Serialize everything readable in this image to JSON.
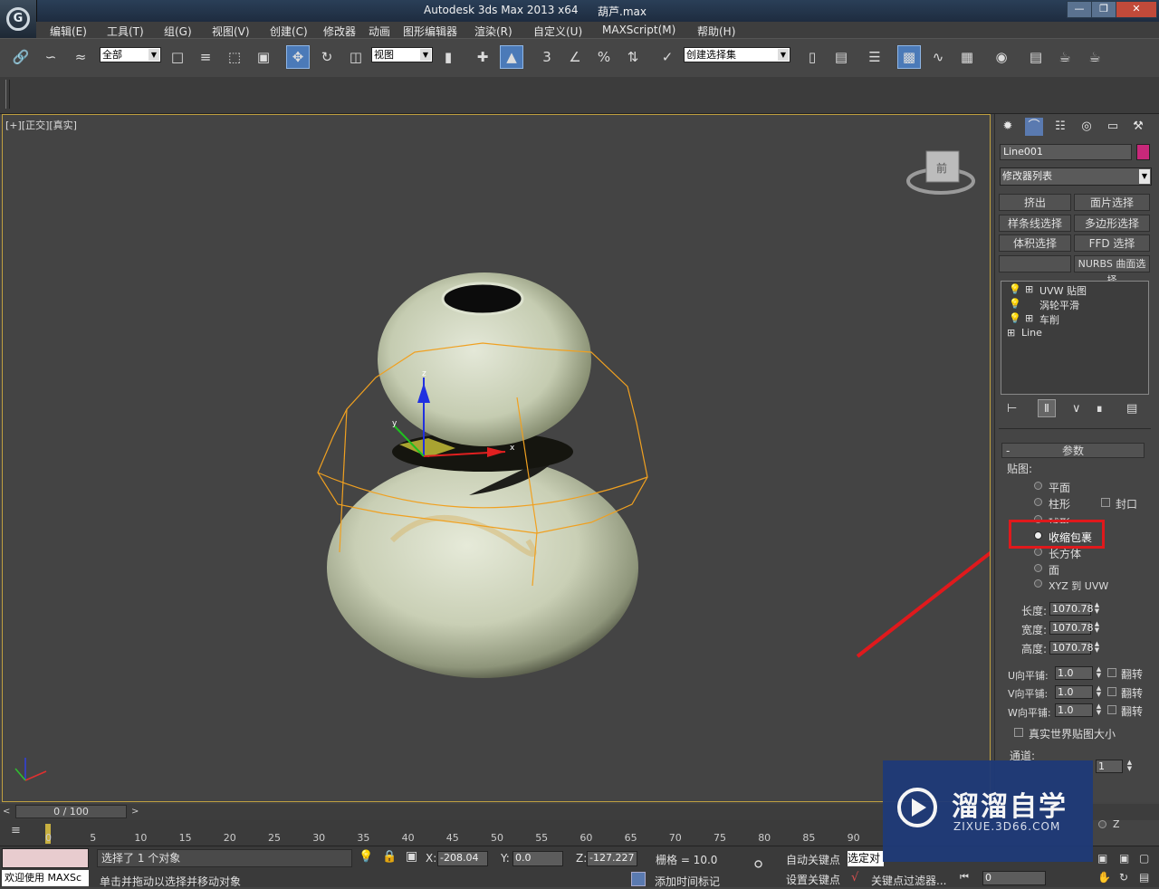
{
  "app": {
    "title": "Autodesk 3ds Max  2013 x64",
    "file": "葫芦.max",
    "logo_glyph": "G"
  },
  "menu": [
    "编辑(E)",
    "工具(T)",
    "组(G)",
    "视图(V)",
    "创建(C)",
    "修改器",
    "动画",
    "图形编辑器",
    "渲染(R)",
    "自定义(U)",
    "MAXScript(M)",
    "帮助(H)"
  ],
  "toolbar": {
    "selection_filter": "全部",
    "ref_coord": "视图",
    "named_selection": "创建选择集",
    "snap_2d": "3",
    "percent_snap": "%"
  },
  "viewport": {
    "label": "[+][正交][真实]",
    "viewcube_label": "前",
    "gizmo_x": "x",
    "gizmo_y": "y",
    "gizmo_z": "z"
  },
  "command_panel": {
    "object_name": "Line001",
    "object_color": "#c8287a",
    "modifier_list": "修改器列表",
    "modifier_buttons": [
      "挤出",
      "面片选择",
      "样条线选择",
      "多边形选择",
      "体积选择",
      "FFD 选择",
      "",
      "NURBS 曲面选择"
    ],
    "stack": [
      {
        "label": "UVW 贴图",
        "bulb": true,
        "plus": true
      },
      {
        "label": "涡轮平滑",
        "bulb": true,
        "plus": false
      },
      {
        "label": "车削",
        "bulb": true,
        "plus": true
      },
      {
        "label": "Line",
        "bulb": false,
        "plus": true
      }
    ],
    "rollout_title": "参数",
    "mapping_group": "贴图:",
    "mapping_options": [
      {
        "label": "平面",
        "selected": false
      },
      {
        "label": "柱形",
        "selected": false
      },
      {
        "label": "球形",
        "selected": false
      },
      {
        "label": "收缩包裹",
        "selected": true
      },
      {
        "label": "长方体",
        "selected": false
      },
      {
        "label": "面",
        "selected": false
      },
      {
        "label": "XYZ 到 UVW",
        "selected": false
      }
    ],
    "cap_label": "封口",
    "length_label": "长度:",
    "length": "1070.78",
    "width_label": "宽度:",
    "width": "1070.78",
    "height_label": "高度:",
    "height": "1070.78",
    "u_tile_label": "U向平铺:",
    "u_tile": "1.0",
    "v_tile_label": "V向平铺:",
    "v_tile": "1.0",
    "w_tile_label": "W向平铺:",
    "w_tile": "1.0",
    "flip_label": "翻转",
    "real_world_label": "真实世界贴图大小",
    "channel_group": "通道:",
    "channel_value": "1",
    "z_label": "Z"
  },
  "timeline": {
    "frame": "0 / 100",
    "ticks": [
      "0",
      "5",
      "10",
      "15",
      "20",
      "25",
      "30",
      "35",
      "40",
      "45",
      "50",
      "55",
      "60",
      "65",
      "70",
      "75",
      "80",
      "85",
      "90"
    ]
  },
  "status": {
    "welcome": "欢迎使用 MAXSc",
    "selected": "选择了 1 个对象",
    "hint": "单击并拖动以选择并移动对象",
    "x_label": "X:",
    "x": "-208.04",
    "y_label": "Y:",
    "y": "0.0",
    "z_label": "Z:",
    "z": "-127.227",
    "grid": "栅格 = 10.0",
    "add_time_tag": "添加时间标记",
    "auto_key": "自动关键点",
    "set_key": "设置关键点",
    "selected_obj": "选定对",
    "key_filters": "关键点过滤器...",
    "frame_field": "0"
  },
  "watermark": {
    "brand": "溜溜自学",
    "url": "ZIXUE.3D66.COM"
  },
  "colors": {
    "highlight_box": "#e0191c",
    "arrow": "#e0191c",
    "gizmo_orange": "#f0a020",
    "marble": "#c9cfb5"
  }
}
